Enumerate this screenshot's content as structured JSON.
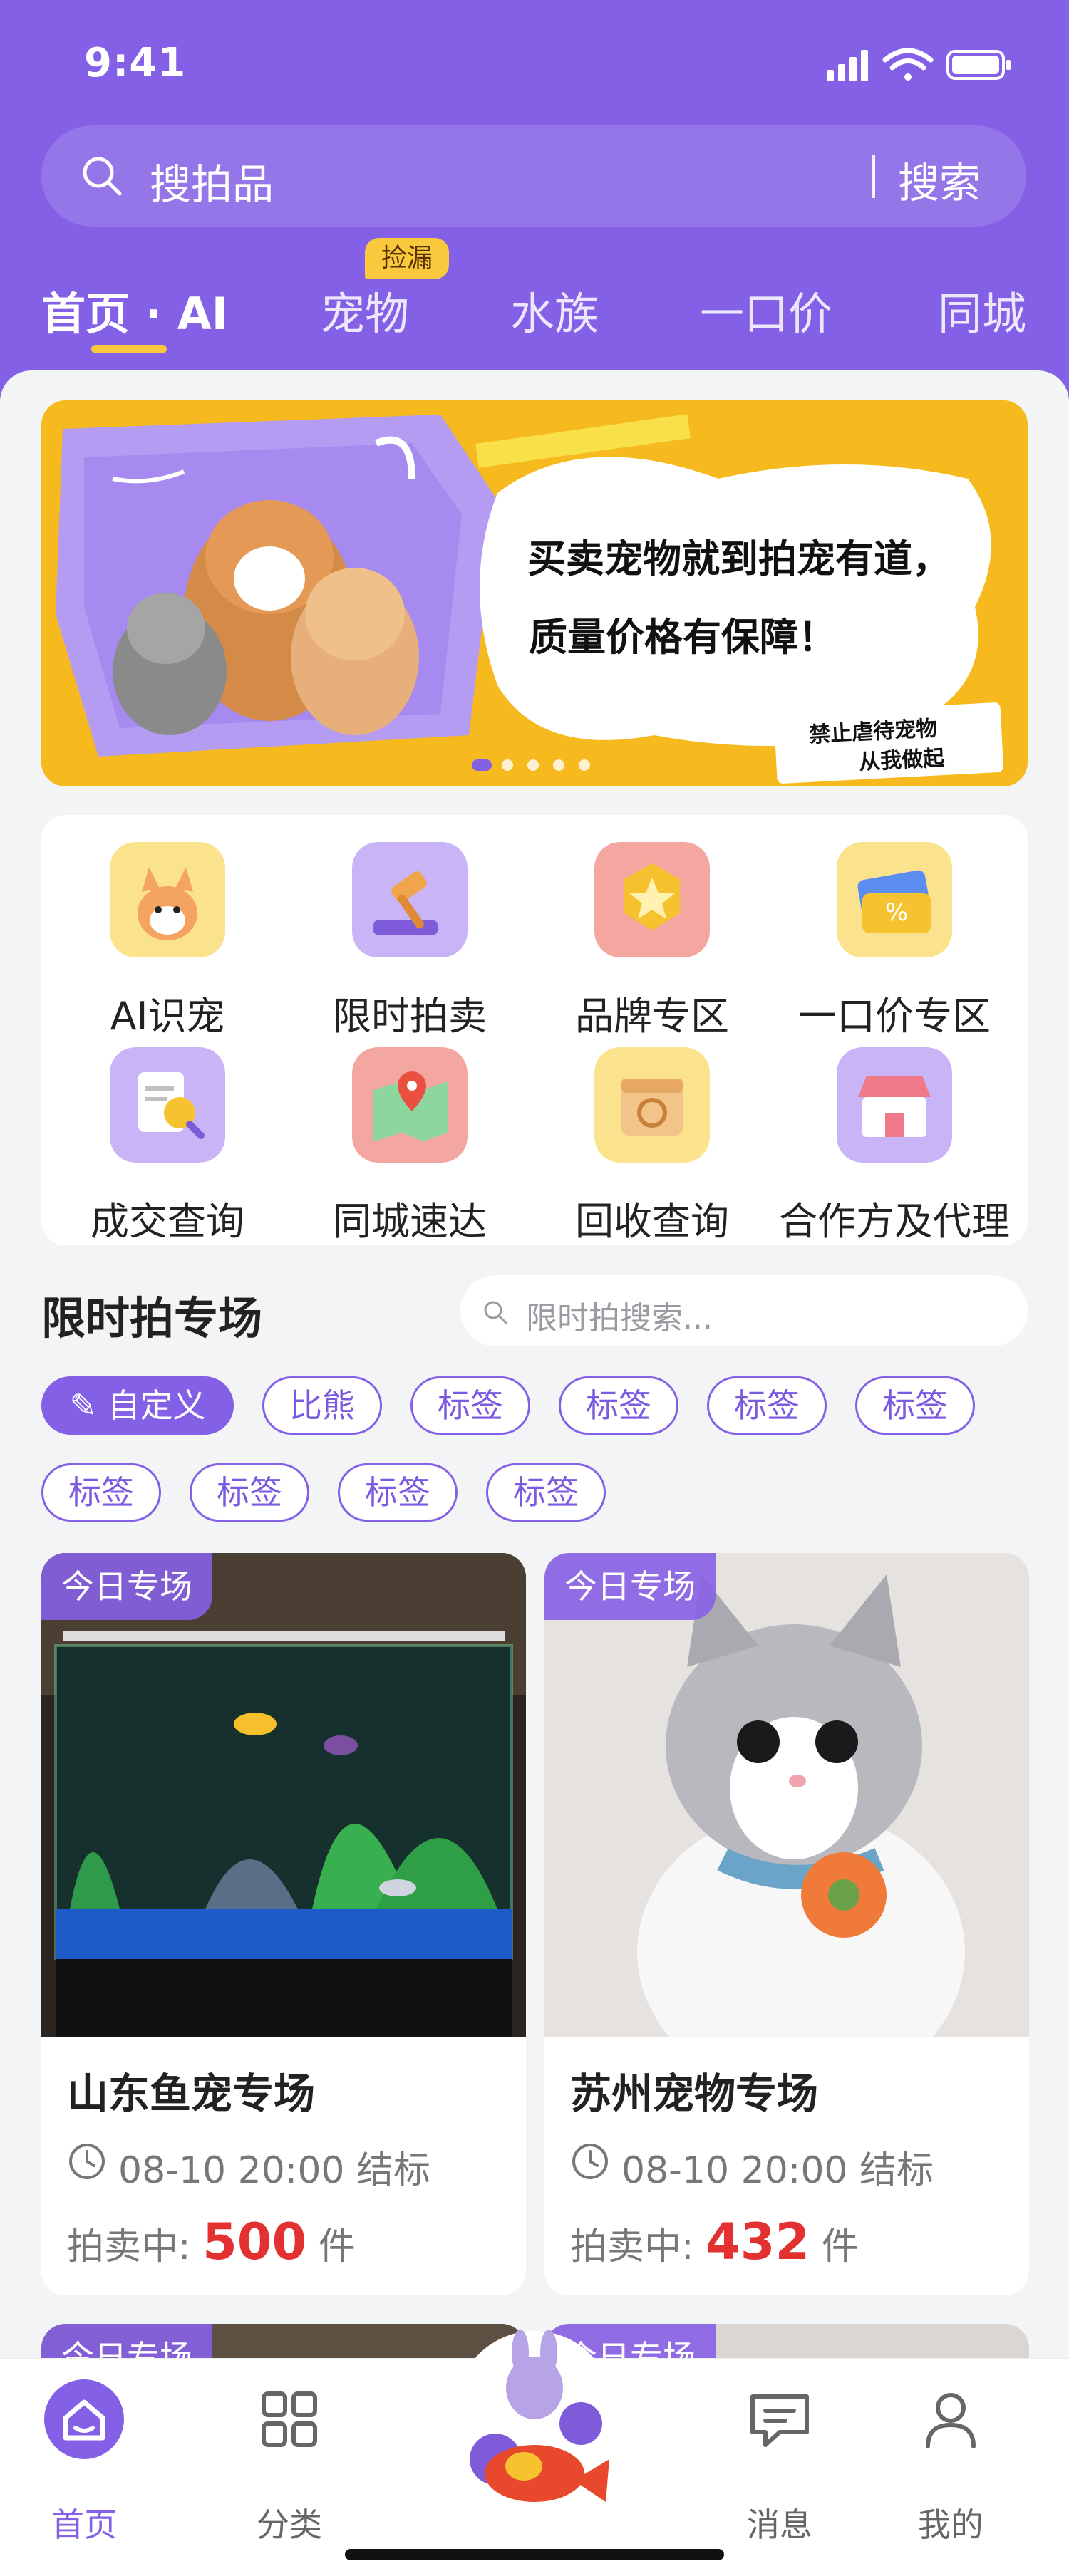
{
  "status_bar": {
    "time": "9:41"
  },
  "search": {
    "placeholder": "搜拍品",
    "button": "搜索"
  },
  "tabs": [
    {
      "label": "首页 · AI",
      "active": true
    },
    {
      "label": "宠物",
      "badge": "捡漏"
    },
    {
      "label": "水族"
    },
    {
      "label": "一口价"
    },
    {
      "label": "同城"
    }
  ],
  "banner": {
    "line1": "买卖宠物就到拍宠有道，",
    "line2": "质量价格有保障！",
    "strip1": "禁止虐待宠物",
    "strip2": "从我做起",
    "dots": 5,
    "active_dot": 0
  },
  "quick_grid": [
    {
      "label": "AI识宠",
      "icon": "puppy-icon"
    },
    {
      "label": "限时拍卖",
      "icon": "gavel-icon"
    },
    {
      "label": "品牌专区",
      "icon": "star-badge-icon"
    },
    {
      "label": "一口价专区",
      "icon": "coupon-icon"
    },
    {
      "label": "成交查询",
      "icon": "search-document-icon"
    },
    {
      "label": "同城速达",
      "icon": "map-pin-icon"
    },
    {
      "label": "回收查询",
      "icon": "recycle-box-icon"
    },
    {
      "label": "合作方及代理",
      "icon": "shop-icon"
    }
  ],
  "section": {
    "title": "限时拍专场",
    "search_placeholder": "限时拍搜索...",
    "chips_row1": [
      "自定义",
      "比熊",
      "标签",
      "标签",
      "标签",
      "标签"
    ],
    "chips_row2": [
      "标签",
      "标签",
      "标签",
      "标签"
    ]
  },
  "cards": [
    {
      "tag": "今日专场",
      "title": "山东鱼宠专场",
      "time": "08-10 20:00 结标",
      "status_label": "拍卖中:",
      "count": "500",
      "unit": "件"
    },
    {
      "tag": "今日专场",
      "title": "苏州宠物专场",
      "time": "08-10 20:00 结标",
      "status_label": "拍卖中:",
      "count": "432",
      "unit": "件"
    }
  ],
  "cards_row2": [
    {
      "tag": "今日专场"
    },
    {
      "tag": "今日专场"
    }
  ],
  "bottom_nav": [
    {
      "label": "首页",
      "active": true
    },
    {
      "label": "分类"
    },
    {
      "label": "消息"
    },
    {
      "label": "我的"
    }
  ],
  "colors": {
    "primary": "#8360e6",
    "accent": "#f8c93c",
    "price": "#e33030"
  }
}
